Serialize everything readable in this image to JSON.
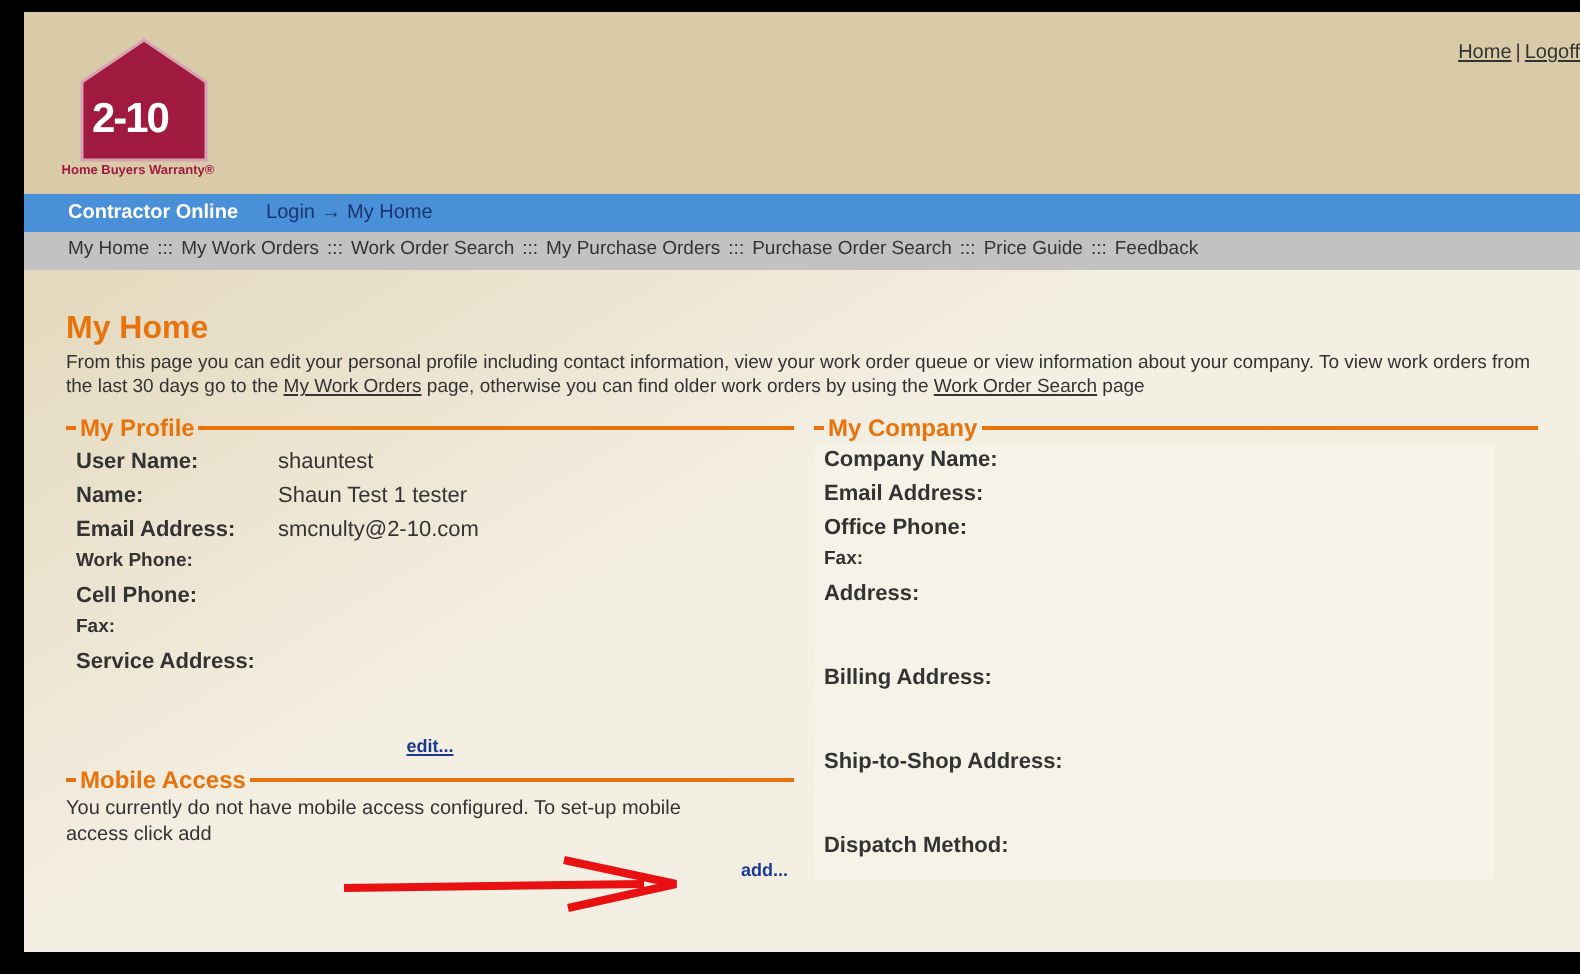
{
  "logo": {
    "mark": "2-10",
    "tagline": "Home Buyers Warranty®"
  },
  "top_links": {
    "separator": "|",
    "items": [
      {
        "label": "Home"
      },
      {
        "label": "Logoff"
      }
    ]
  },
  "blue_bar": {
    "title": "Contractor Online",
    "breadcrumb": [
      "Login",
      "My Home"
    ],
    "separator": "→"
  },
  "nav": {
    "separator": ":::",
    "items": [
      "My Home",
      "My Work Orders",
      "Work Order Search",
      "My Purchase Orders",
      "Purchase Order Search",
      "Price Guide",
      "Feedback"
    ]
  },
  "page_title": "My Home",
  "intro": {
    "before": "From this page you can edit your personal profile including contact information, view your work order queue or view information about your company. To view work orders from the last 30 days go to the ",
    "link1": "My Work Orders",
    "middle": " page, otherwise you can find older work orders by using the ",
    "link2": "Work Order Search",
    "after": " page"
  },
  "profile": {
    "title": "My Profile",
    "fields": [
      {
        "label": "User Name:",
        "value": "shauntest",
        "kind": "line"
      },
      {
        "label": "Name:",
        "value": "Shaun Test 1 tester",
        "kind": "line"
      },
      {
        "label": "Email Address:",
        "value": "smcnulty@2-10.com",
        "kind": "line"
      },
      {
        "label": "Work Phone:",
        "kind": "small"
      },
      {
        "label": "Cell Phone:",
        "kind": "line"
      },
      {
        "label": "Fax:",
        "kind": "small"
      },
      {
        "label": "Service Address:",
        "kind": "address"
      }
    ],
    "edit_link": "edit..."
  },
  "mobile": {
    "title": "Mobile Access",
    "text": "You currently do not have mobile access configured. To set-up mobile access click add",
    "add_link": "add..."
  },
  "company": {
    "title": "My Company",
    "fields": [
      {
        "label": "Company Name:",
        "kind": "line"
      },
      {
        "label": "Email Address:",
        "kind": "line"
      },
      {
        "label": "Office Phone:",
        "kind": "line"
      },
      {
        "label": "Fax:",
        "kind": "small"
      },
      {
        "label": "Address:",
        "kind": "address"
      },
      {
        "label": "Billing Address:",
        "kind": "address"
      },
      {
        "label": "Ship-to-Shop Address:",
        "kind": "address"
      },
      {
        "label": "Dispatch Method:",
        "kind": "line"
      }
    ]
  }
}
